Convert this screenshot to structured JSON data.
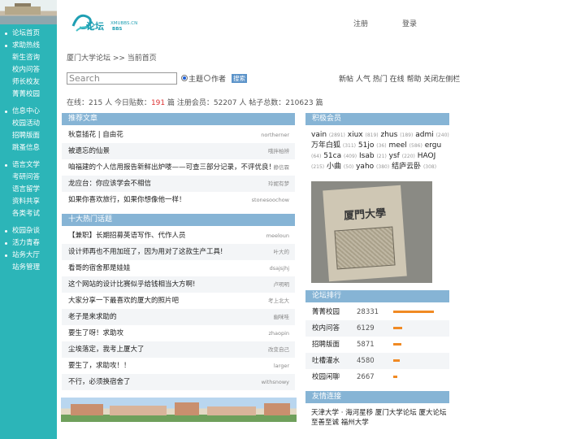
{
  "header": {
    "logo_text": "论坛",
    "logo_url": "XMUBBS.CN",
    "logo_bbs": "BBS",
    "register": "注册",
    "login": "登录"
  },
  "sidebar": {
    "items": [
      {
        "label": "论坛首页",
        "head": true
      },
      {
        "label": "求助热线",
        "head": true
      },
      {
        "label": "新生咨询",
        "head": false
      },
      {
        "label": "校内问答",
        "head": false
      },
      {
        "label": "师长校友",
        "head": false
      },
      {
        "label": "菁菁校园",
        "head": false
      },
      {
        "label": "信息中心",
        "head": true
      },
      {
        "label": "校园活动",
        "head": false
      },
      {
        "label": "招聘版面",
        "head": false
      },
      {
        "label": "跳蚤信息",
        "head": false
      },
      {
        "label": "语言文学",
        "head": true
      },
      {
        "label": "考研问答",
        "head": false
      },
      {
        "label": "语言留学",
        "head": false
      },
      {
        "label": "资料共享",
        "head": false
      },
      {
        "label": "各类考试",
        "head": false
      },
      {
        "label": "校园杂谈",
        "head": true
      },
      {
        "label": "活力青春",
        "head": true
      },
      {
        "label": "站务大厅",
        "head": true
      },
      {
        "label": "站务管理",
        "head": false
      }
    ]
  },
  "breadcrumb": "厦门大学论坛 >> 当前首页",
  "search": {
    "placeholder": "Search",
    "opt_subject": "主题",
    "opt_author": "作者",
    "button": "搜索"
  },
  "quick_links": "新帖 人气 热门 在线 帮助 关闭左侧栏",
  "stats": {
    "online_label": "在线：",
    "online": "215",
    "online_unit": " 人 今日贴数：",
    "today_posts": "191",
    "mid": " 篇 注册会员：",
    "members": "52207",
    "posts_label": " 人 帖子总数：",
    "total_posts": "210623",
    "end": " 篇"
  },
  "recommended": {
    "title": "推荐文章",
    "rows": [
      {
        "title": "秋意插花 | 自由花",
        "author": "northerner"
      },
      {
        "title": "被遗忘的仙景",
        "author": "哦拌柏辨"
      },
      {
        "title": "咱福建的个人信用报告新鲜出炉喽——可查三部分记录，不评优良！",
        "author": "静信霖"
      },
      {
        "title": "龙应台：你应该学会不相信",
        "author": "玲妮有梦"
      },
      {
        "title": "如果你喜欢旅行，如果你想像他一样！",
        "author": "stonesoochow"
      }
    ]
  },
  "hot_topics": {
    "title": "十大热门话题",
    "rows": [
      {
        "title": "【兼职】长期招募英语写作、代作人员",
        "author": "meeloun"
      },
      {
        "title": "设计师再也不用加班了，因为用对了这款生产工具!",
        "author": "叶大的"
      },
      {
        "title": "看哥的宿舍那是娃娃",
        "author": "dsajsjhj"
      },
      {
        "title": "这个网站的设计比赛似乎给钱相当大方啊!",
        "author": "卢明明"
      },
      {
        "title": "大家分享一下最喜欢的厦大的照片吧",
        "author": "考上北大"
      },
      {
        "title": "老子是来求助的",
        "author": "幽咪哇"
      },
      {
        "title": "要生了呀！求助攻",
        "author": "zhaopin"
      },
      {
        "title": "尘埃落定，我考上厦大了",
        "author": "改变自己"
      },
      {
        "title": "要生了，求助攻！！",
        "author": "larger"
      },
      {
        "title": "不行，必须换宿舍了",
        "author": "withsnowy"
      }
    ]
  },
  "active_members": {
    "title": "积极会员",
    "list": [
      {
        "name": "vain",
        "count": "(2891)"
      },
      {
        "name": "xiux",
        "count": "(819)"
      },
      {
        "name": "zhus",
        "count": "(189)"
      },
      {
        "name": "admi",
        "count": "(240)"
      },
      {
        "name": "万年白狐",
        "count": "(311)"
      },
      {
        "name": "51jo",
        "count": "(36)"
      },
      {
        "name": "meel",
        "count": "(586)"
      },
      {
        "name": "ergu",
        "count": "(64)"
      },
      {
        "name": "51ca",
        "count": "(409)"
      },
      {
        "name": "Isab",
        "count": "(21)"
      },
      {
        "name": "ysf",
        "count": "(220)"
      },
      {
        "name": "HAOJ",
        "count": "(215)"
      },
      {
        "name": "小曲",
        "count": "(50)"
      },
      {
        "name": "yaho",
        "count": "(380)"
      },
      {
        "name": "结庐云卧",
        "count": "(308)"
      }
    ]
  },
  "photo_title": "厦門大學",
  "forum_ranking": {
    "title": "论坛排行",
    "rows": [
      {
        "name": "菁菁校园",
        "count": "28331",
        "value": 28331
      },
      {
        "name": "校内问答",
        "count": "6129",
        "value": 6129
      },
      {
        "name": "招聘版面",
        "count": "5871",
        "value": 5871
      },
      {
        "name": "吐槽灌水",
        "count": "4580",
        "value": 4580
      },
      {
        "name": "校园闲聊",
        "count": "2667",
        "value": 2667
      }
    ]
  },
  "friend_links": {
    "title": "友情连接",
    "text": "天津大学 · 海河星移 厦门大学论坛 厦大论坛 至善至诚 福州大学"
  },
  "colors": {
    "sidebar": "#2cb5b8",
    "panel_head": "#86b4d5",
    "accent_red": "#dd3333",
    "rank_bar": "#f08a24"
  }
}
